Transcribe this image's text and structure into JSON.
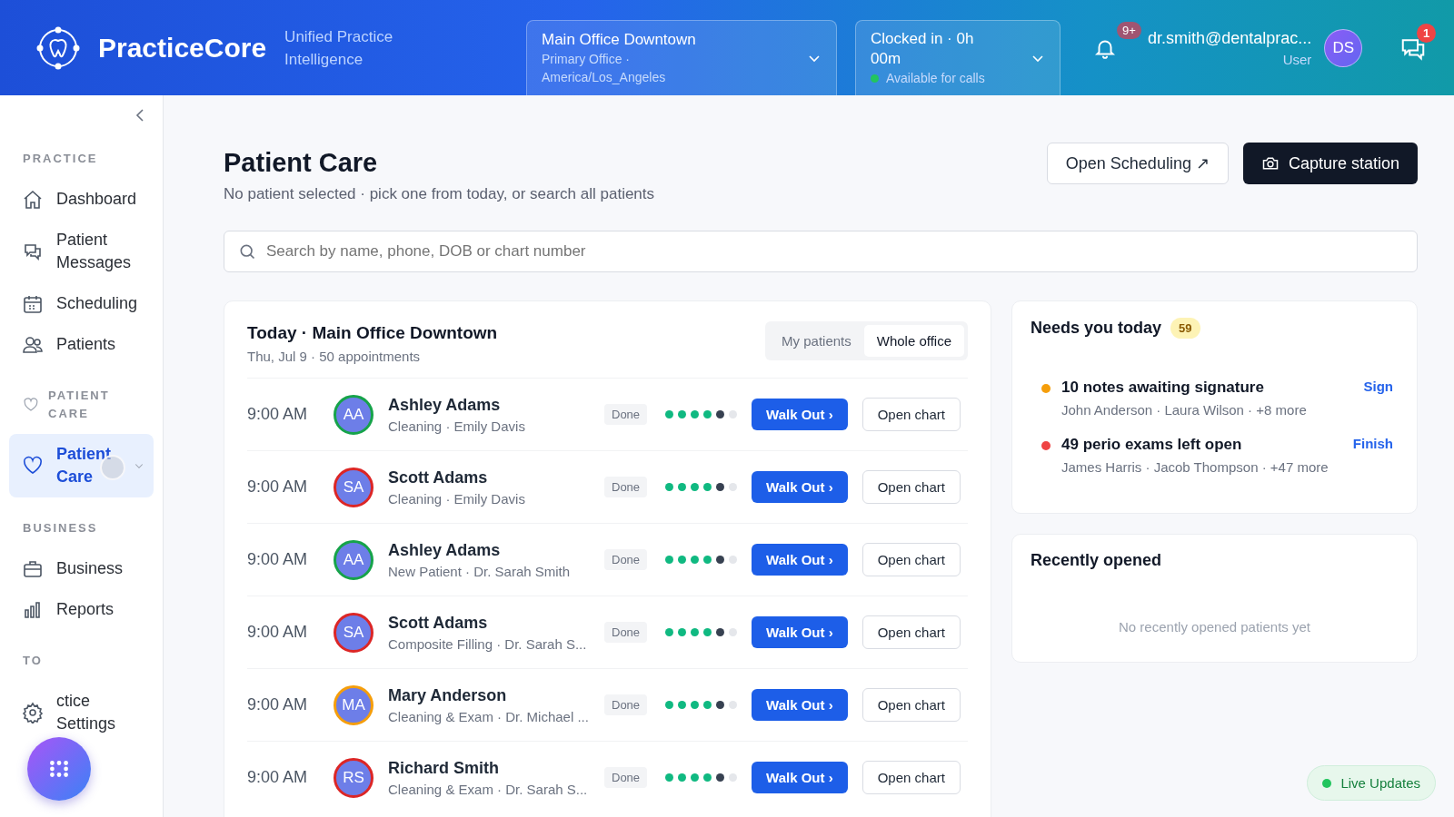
{
  "header": {
    "brand": "PracticeCore",
    "tagline": "Unified Practice Intelligence",
    "location": {
      "name": "Main Office Downtown",
      "detail": "Primary Office · America/Los_Angeles"
    },
    "clock": {
      "status": "Clocked in · 0h 00m",
      "availability": "Available for calls",
      "available": true
    },
    "notifications_badge": "9+",
    "user": {
      "email": "dr.smith@dentalprac...",
      "role": "User",
      "initials": "DS"
    },
    "messages_badge": "1"
  },
  "sidebar": {
    "sections": [
      {
        "label": "PRACTICE",
        "items": [
          {
            "label": "Dashboard",
            "selected": false
          },
          {
            "label": "Patient Messages",
            "selected": false
          },
          {
            "label": "Scheduling",
            "selected": false
          },
          {
            "label": "Patients",
            "selected": false
          }
        ]
      },
      {
        "label": "PATIENT CARE",
        "items": [
          {
            "label": "Patient Care",
            "selected": true,
            "loading": true
          }
        ]
      },
      {
        "label": "BUSINESS",
        "items": [
          {
            "label": "Business",
            "selected": false
          },
          {
            "label": "Reports",
            "selected": false
          }
        ]
      },
      {
        "label": "TO",
        "items": [
          {
            "label": "ctice Settings",
            "selected": false
          }
        ]
      }
    ]
  },
  "page": {
    "title": "Patient Care",
    "subtitle": "No patient selected · pick one from today, or search all patients",
    "buttons": [
      "Open Scheduling ↗",
      "Capture station"
    ],
    "search": {
      "placeholder": "Search by name, phone, DOB or chart number"
    }
  },
  "today": {
    "title": "Today · Main Office Downtown",
    "subtitle": "Thu, Jul 9 · 50 appointments",
    "tabs": [
      {
        "label": "My patients",
        "selected": false
      },
      {
        "label": "Whole office",
        "selected": true
      }
    ],
    "rows": [
      {
        "time": "9:00 AM",
        "initials": "AA",
        "color": "#16a34a",
        "name": "Ashley Adams",
        "detail": "Cleaning · Emily Davis",
        "status": "Done",
        "stars": 4,
        "action": "Walk Out ›",
        "chart": "Open chart"
      },
      {
        "time": "9:00 AM",
        "initials": "SA",
        "color": "#dc2626",
        "name": "Scott Adams",
        "detail": "Cleaning · Emily Davis",
        "status": "Done",
        "stars": 4,
        "action": "Walk Out ›",
        "chart": "Open chart"
      },
      {
        "time": "9:00 AM",
        "initials": "AA",
        "color": "#16a34a",
        "name": "Ashley Adams",
        "detail": "New Patient · Dr. Sarah Smith",
        "status": "Done",
        "stars": 4,
        "action": "Walk Out ›",
        "chart": "Open chart"
      },
      {
        "time": "9:00 AM",
        "initials": "SA",
        "color": "#dc2626",
        "name": "Scott Adams",
        "detail": "Composite Filling · Dr. Sarah S...",
        "status": "Done",
        "stars": 4,
        "action": "Walk Out ›",
        "chart": "Open chart"
      },
      {
        "time": "9:00 AM",
        "initials": "MA",
        "color": "#f59e0b",
        "name": "Mary Anderson",
        "detail": "Cleaning & Exam · Dr. Michael ...",
        "status": "Done",
        "stars": 4,
        "action": "Walk Out ›",
        "chart": "Open chart"
      },
      {
        "time": "9:00 AM",
        "initials": "RS",
        "color": "#dc2626",
        "name": "Richard Smith",
        "detail": "Cleaning & Exam · Dr. Sarah S...",
        "status": "Done",
        "stars": 4,
        "action": "Walk Out ›",
        "chart": "Open chart"
      }
    ]
  },
  "needs": {
    "title": "Needs you today",
    "count": "59",
    "items": [
      {
        "title": "10 notes awaiting signature",
        "names": "John Anderson · Laura Wilson · +8 more",
        "action": "Sign",
        "color": "#f59e0b"
      },
      {
        "title": "49 perio exams left open",
        "names": "James Harris · Jacob Thompson · +47 more",
        "action": "Finish",
        "color": "#ef4444"
      }
    ]
  },
  "recent": {
    "title": "Recently opened",
    "empty": "No recently opened patients yet"
  },
  "live": {
    "label": "Live Updates",
    "on": true
  }
}
